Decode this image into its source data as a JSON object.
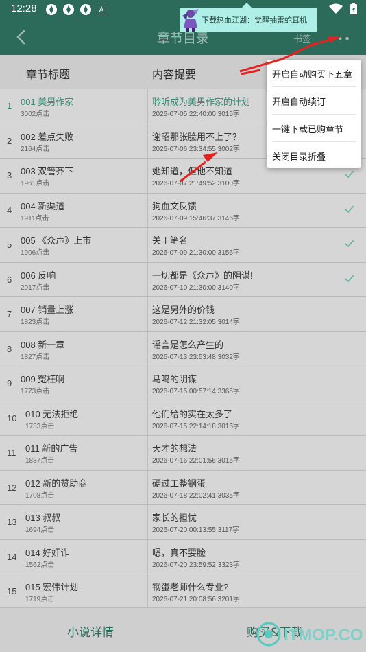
{
  "status": {
    "time": "12:28"
  },
  "header": {
    "title": "章节目录",
    "bookmark": "书签",
    "more": "•••"
  },
  "ad": {
    "text": "下载热血江湖：觉醒抽雷蛇耳机"
  },
  "columns": {
    "title": "章节标题",
    "summary": "内容提要"
  },
  "chapters": [
    {
      "num": "1",
      "name": "001 美男作家",
      "clicks": "3002点击",
      "summary": "聆听成为美男作家的计划",
      "meta": "2026-07-05 22:40:00  3015字",
      "read": false
    },
    {
      "num": "2",
      "name": "002 差点失败",
      "clicks": "2164点击",
      "summary": "谢昭那张脸用不上了？",
      "meta": "2026-07-06 23:34:55  3002字",
      "read": false
    },
    {
      "num": "3",
      "name": "003 双管齐下",
      "clicks": "1961点击",
      "summary": "她知道，但他不知道",
      "meta": "2026-07-07 21:49:52  3100字",
      "read": true
    },
    {
      "num": "4",
      "name": "004 新渠道",
      "clicks": "1911点击",
      "summary": "狗血文反馈",
      "meta": "2026-07-09 15:46:37  3146字",
      "read": true
    },
    {
      "num": "5",
      "name": "005 《众声》上市",
      "clicks": "1906点击",
      "summary": "关于笔名",
      "meta": "2026-07-09 21:30:00  3156字",
      "read": true
    },
    {
      "num": "6",
      "name": "006 反响",
      "clicks": "2017点击",
      "summary": "一切都是《众声》的阴谋!",
      "meta": "2026-07-10 21:30:00  3140字",
      "read": true
    },
    {
      "num": "7",
      "name": "007 销量上涨",
      "clicks": "1823点击",
      "summary": "这是另外的价钱",
      "meta": "2026-07-12 21:32:05  3014字",
      "read": false
    },
    {
      "num": "8",
      "name": "008 新一章",
      "clicks": "1827点击",
      "summary": "谣言是怎么产生的",
      "meta": "2026-07-13 23:53:48  3032字",
      "read": false
    },
    {
      "num": "9",
      "name": "009 冤枉啊",
      "clicks": "1773点击",
      "summary": "马鸣的阴谋",
      "meta": "2026-07-15 00:57:14  3365字",
      "read": false
    },
    {
      "num": "10",
      "name": "010 无法拒绝",
      "clicks": "1733点击",
      "summary": "他们给的实在太多了",
      "meta": "2026-07-15 22:14:18  3016字",
      "read": false
    },
    {
      "num": "11",
      "name": "011 新的广告",
      "clicks": "1887点击",
      "summary": "天才的想法",
      "meta": "2026-07-16 22:01:56  3015字",
      "read": false
    },
    {
      "num": "12",
      "name": "012 新的赞助商",
      "clicks": "1708点击",
      "summary": "硬过工整钢蛋",
      "meta": "2026-07-18 22:02:41  3035字",
      "read": false
    },
    {
      "num": "13",
      "name": "013 叔叔",
      "clicks": "1694点击",
      "summary": "家长的担忧",
      "meta": "2026-07-20 00:13:55  3117字",
      "read": false
    },
    {
      "num": "14",
      "name": "014 好奸诈",
      "clicks": "1562点击",
      "summary": "嗯，真不要脸",
      "meta": "2026-07-20 23:59:52  3323字",
      "read": false
    },
    {
      "num": "15",
      "name": "015 宏伟计划",
      "clicks": "1719点击",
      "summary": "钢蛋老师什么专业?",
      "meta": "2026-07-21 20:08:56  3201字",
      "read": false
    }
  ],
  "menu": {
    "items": [
      "开启自动购买下五章",
      "开启自动续订",
      "一键下载已购章节",
      "关闭目录折叠"
    ]
  },
  "bottom": {
    "detail": "小说详情",
    "buy": "购买&下载"
  },
  "watermark": {
    "text": "ITMOP.COM"
  },
  "colors": {
    "primary": "#2c6a5a",
    "accent": "#2f8a72",
    "check": "#5fb39c",
    "arrow": "#e52222"
  },
  "icons": [
    "back-arrow-icon",
    "more-icon",
    "check-icon",
    "signal-icon",
    "wifi-icon",
    "battery-icon",
    "notification-icon"
  ]
}
